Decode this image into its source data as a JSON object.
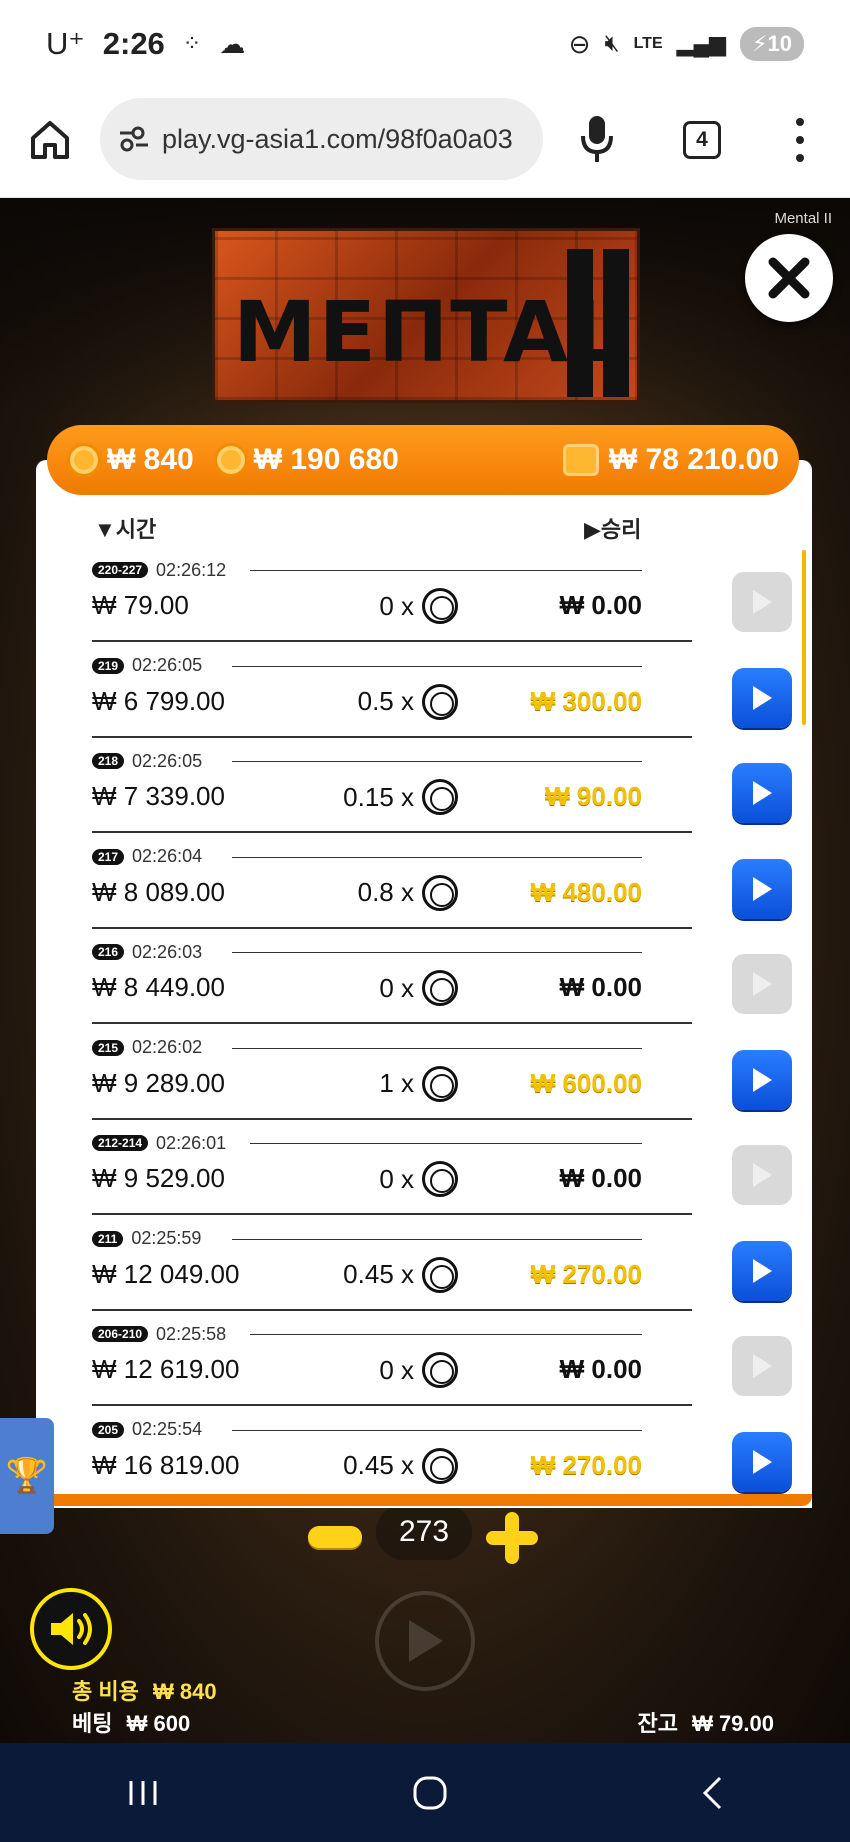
{
  "status": {
    "carrier": "U⁺",
    "time": "2:26",
    "network": "LTE",
    "battery": "10"
  },
  "browser": {
    "url": "play.vg-asia1.com/98f0a0a03",
    "tab_count": "4"
  },
  "game": {
    "corner_label": "Mental II",
    "logo_text": "MEПTAL"
  },
  "balance_bar": {
    "bet": "₩ 840",
    "jackpot": "₩ 190 680",
    "wallet": "₩ 78 210.00"
  },
  "history": {
    "time_header": "▼시간",
    "win_header": "▶승리",
    "rows": [
      {
        "round": "220-227",
        "time": "02:26:12",
        "stake": "₩ 79.00",
        "mult": "0 x",
        "win": "₩ 0.00",
        "won": false
      },
      {
        "round": "219",
        "time": "02:26:05",
        "stake": "₩ 6 799.00",
        "mult": "0.5 x",
        "win": "₩ 300.00",
        "won": true
      },
      {
        "round": "218",
        "time": "02:26:05",
        "stake": "₩ 7 339.00",
        "mult": "0.15 x",
        "win": "₩ 90.00",
        "won": true
      },
      {
        "round": "217",
        "time": "02:26:04",
        "stake": "₩ 8 089.00",
        "mult": "0.8 x",
        "win": "₩ 480.00",
        "won": true
      },
      {
        "round": "216",
        "time": "02:26:03",
        "stake": "₩ 8 449.00",
        "mult": "0 x",
        "win": "₩ 0.00",
        "won": false
      },
      {
        "round": "215",
        "time": "02:26:02",
        "stake": "₩ 9 289.00",
        "mult": "1 x",
        "win": "₩ 600.00",
        "won": true
      },
      {
        "round": "212-214",
        "time": "02:26:01",
        "stake": "₩ 9 529.00",
        "mult": "0 x",
        "win": "₩ 0.00",
        "won": false
      },
      {
        "round": "211",
        "time": "02:25:59",
        "stake": "₩ 12 049.00",
        "mult": "0.45 x",
        "win": "₩ 270.00",
        "won": true
      },
      {
        "round": "206-210",
        "time": "02:25:58",
        "stake": "₩ 12 619.00",
        "mult": "0 x",
        "win": "₩ 0.00",
        "won": false
      },
      {
        "round": "205",
        "time": "02:25:54",
        "stake": "₩ 16 819.00",
        "mult": "0.45 x",
        "win": "₩ 270.00",
        "won": true
      }
    ]
  },
  "controls": {
    "bet_count": "273",
    "total_cost_label": "총 비용",
    "total_cost_value": "₩ 840",
    "bet_label": "베팅",
    "bet_value": "₩ 600",
    "balance_label": "잔고",
    "balance_value": "₩ 79.00"
  },
  "colors": {
    "accent_orange": "#f07a00",
    "win_gold": "#f2c200",
    "play_blue": "#0a4fd8"
  }
}
